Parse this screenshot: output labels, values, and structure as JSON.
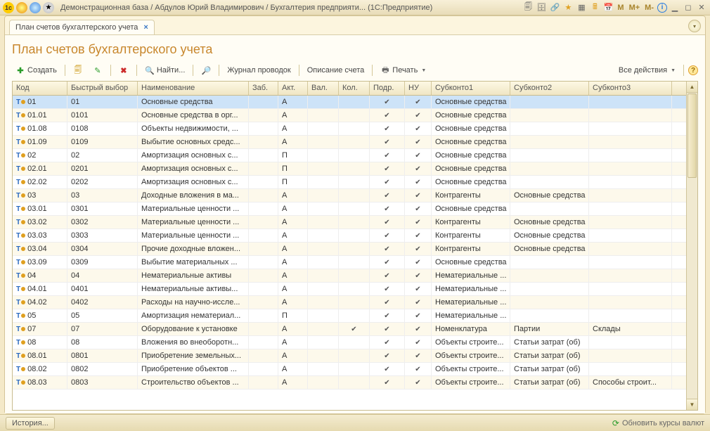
{
  "titlebar": {
    "title": "Демонстрационная база / Абдулов Юрий Владимирович / Бухгалтерия предприяти...   (1С:Предприятие)",
    "m_buttons": [
      "M",
      "M+",
      "M-"
    ]
  },
  "tab": {
    "label": "План счетов бухгалтерского учета"
  },
  "page_title": "План счетов бухгалтерского учета",
  "toolbar": {
    "create": "Создать",
    "find": "Найти...",
    "journal": "Журнал проводок",
    "desc": "Описание счета",
    "print": "Печать",
    "all_actions": "Все действия"
  },
  "columns": {
    "code": "Код",
    "quick": "Быстрый выбор",
    "name": "Наименование",
    "zab": "Заб.",
    "akt": "Акт.",
    "val": "Вал.",
    "kol": "Кол.",
    "podr": "Подр.",
    "nu": "НУ",
    "sub1": "Субконто1",
    "sub2": "Субконто2",
    "sub3": "Субконто3"
  },
  "rows": [
    {
      "code": "01",
      "quick": "01",
      "name": "Основные средства",
      "akt": "А",
      "podr": true,
      "nu": true,
      "sub1": "Основные средства",
      "sel": true
    },
    {
      "code": "01.01",
      "quick": "0101",
      "name": "Основные средства в орг...",
      "akt": "А",
      "podr": true,
      "nu": true,
      "sub1": "Основные средства"
    },
    {
      "code": "01.08",
      "quick": "0108",
      "name": "Объекты недвижимости, ...",
      "akt": "А",
      "podr": true,
      "nu": true,
      "sub1": "Основные средства"
    },
    {
      "code": "01.09",
      "quick": "0109",
      "name": "Выбытие основных средс...",
      "akt": "А",
      "podr": true,
      "nu": true,
      "sub1": "Основные средства"
    },
    {
      "code": "02",
      "quick": "02",
      "name": "Амортизация основных с...",
      "akt": "П",
      "podr": true,
      "nu": true,
      "sub1": "Основные средства"
    },
    {
      "code": "02.01",
      "quick": "0201",
      "name": "Амортизация основных с...",
      "akt": "П",
      "podr": true,
      "nu": true,
      "sub1": "Основные средства"
    },
    {
      "code": "02.02",
      "quick": "0202",
      "name": "Амортизация основных с...",
      "akt": "П",
      "podr": true,
      "nu": true,
      "sub1": "Основные средства"
    },
    {
      "code": "03",
      "quick": "03",
      "name": "Доходные вложения в ма...",
      "akt": "А",
      "podr": true,
      "nu": true,
      "sub1": "Контрагенты",
      "sub2": "Основные средства"
    },
    {
      "code": "03.01",
      "quick": "0301",
      "name": "Материальные ценности ...",
      "akt": "А",
      "podr": true,
      "nu": true,
      "sub1": "Основные средства"
    },
    {
      "code": "03.02",
      "quick": "0302",
      "name": "Материальные ценности ...",
      "akt": "А",
      "podr": true,
      "nu": true,
      "sub1": "Контрагенты",
      "sub2": "Основные средства"
    },
    {
      "code": "03.03",
      "quick": "0303",
      "name": "Материальные ценности ...",
      "akt": "А",
      "podr": true,
      "nu": true,
      "sub1": "Контрагенты",
      "sub2": "Основные средства"
    },
    {
      "code": "03.04",
      "quick": "0304",
      "name": "Прочие доходные вложен...",
      "akt": "А",
      "podr": true,
      "nu": true,
      "sub1": "Контрагенты",
      "sub2": "Основные средства"
    },
    {
      "code": "03.09",
      "quick": "0309",
      "name": "Выбытие материальных ...",
      "akt": "А",
      "podr": true,
      "nu": true,
      "sub1": "Основные средства"
    },
    {
      "code": "04",
      "quick": "04",
      "name": "Нематериальные активы",
      "akt": "А",
      "podr": true,
      "nu": true,
      "sub1": "Нематериальные ..."
    },
    {
      "code": "04.01",
      "quick": "0401",
      "name": "Нематериальные активы...",
      "akt": "А",
      "podr": true,
      "nu": true,
      "sub1": "Нематериальные ..."
    },
    {
      "code": "04.02",
      "quick": "0402",
      "name": "Расходы на научно-иссле...",
      "akt": "А",
      "podr": true,
      "nu": true,
      "sub1": "Нематериальные ..."
    },
    {
      "code": "05",
      "quick": "05",
      "name": "Амортизация нематериал...",
      "akt": "П",
      "podr": true,
      "nu": true,
      "sub1": "Нематериальные ..."
    },
    {
      "code": "07",
      "quick": "07",
      "name": "Оборудование к установке",
      "akt": "А",
      "kol": true,
      "podr": true,
      "nu": true,
      "sub1": "Номенклатура",
      "sub2": "Партии",
      "sub3": "Склады"
    },
    {
      "code": "08",
      "quick": "08",
      "name": "Вложения во внеоборотн...",
      "akt": "А",
      "podr": true,
      "nu": true,
      "sub1": "Объекты строите...",
      "sub2": "Статьи затрат (об)"
    },
    {
      "code": "08.01",
      "quick": "0801",
      "name": "Приобретение земельных...",
      "akt": "А",
      "podr": true,
      "nu": true,
      "sub1": "Объекты строите...",
      "sub2": "Статьи затрат (об)"
    },
    {
      "code": "08.02",
      "quick": "0802",
      "name": "Приобретение объектов ...",
      "akt": "А",
      "podr": true,
      "nu": true,
      "sub1": "Объекты строите...",
      "sub2": "Статьи затрат (об)"
    },
    {
      "code": "08.03",
      "quick": "0803",
      "name": "Строительство объектов ...",
      "akt": "А",
      "podr": true,
      "nu": true,
      "sub1": "Объекты строите...",
      "sub2": "Статьи затрат (об)",
      "sub3": "Способы строит..."
    }
  ],
  "statusbar": {
    "history": "История...",
    "refresh": "Обновить курсы валют"
  }
}
